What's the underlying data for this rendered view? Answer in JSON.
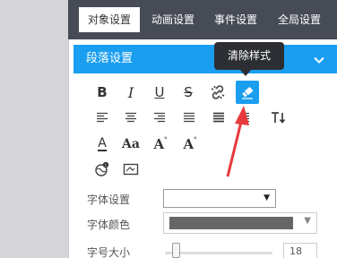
{
  "tabs": [
    {
      "label": "对象设置",
      "active": true
    },
    {
      "label": "动画设置",
      "active": false
    },
    {
      "label": "事件设置",
      "active": false
    },
    {
      "label": "全局设置",
      "active": false
    }
  ],
  "panel": {
    "title": "段落设置"
  },
  "tooltip": {
    "text": "清除样式"
  },
  "toolbar": {
    "bold": "B",
    "italic": "I",
    "underline": "U",
    "strike": "S",
    "font_size_a": "A",
    "font_size_aa": "Aa",
    "font_size_increase": "A",
    "font_size_decrease": "A"
  },
  "form": {
    "font_label": "字体设置",
    "font_value": "",
    "color_label": "字体颜色",
    "size_label": "字号大小",
    "size_value": "18"
  },
  "colors": {
    "accent": "#1a9ef0",
    "tabbar": "#474b56",
    "text_color_swatch": "#666666",
    "annotation_arrow": "#e8393c"
  }
}
